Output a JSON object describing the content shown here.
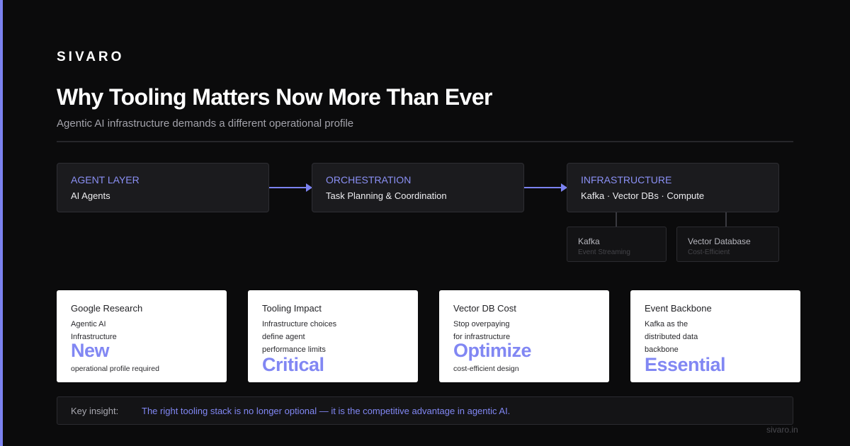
{
  "brand": "SIVARO",
  "title": "Why Tooling Matters Now More Than Ever",
  "subtitle": "Agentic AI infrastructure demands a different operational profile",
  "colors": {
    "accent": "#7b82f0",
    "background": "#0b0b0c",
    "card": "#ffffff",
    "highlight": "#8187f3"
  },
  "flow": [
    {
      "label": "AGENT LAYER",
      "desc": "AI Agents"
    },
    {
      "label": "ORCHESTRATION",
      "desc": "Task Planning & Coordination"
    },
    {
      "label": "INFRASTRUCTURE",
      "desc": "Kafka · Vector DBs · Compute"
    }
  ],
  "sub_components": [
    {
      "name": "Kafka",
      "note": "Event Streaming"
    },
    {
      "name": "Vector Database",
      "note": "Cost-Efficient"
    }
  ],
  "cards": [
    {
      "title": "Google Research",
      "lines": [
        "Agentic AI",
        "Infrastructure"
      ],
      "big": "New",
      "footer": "operational profile required"
    },
    {
      "title": "Tooling Impact",
      "lines": [
        "Infrastructure choices",
        "define agent",
        "performance limits"
      ],
      "big": "Critical",
      "footer": ""
    },
    {
      "title": "Vector DB Cost",
      "lines": [
        "Stop overpaying",
        "for infrastructure"
      ],
      "big": "Optimize",
      "footer": "cost-efficient design"
    },
    {
      "title": "Event Backbone",
      "lines": [
        "Kafka as the",
        "distributed data",
        "backbone"
      ],
      "big": "Essential",
      "footer": ""
    }
  ],
  "insight": {
    "label": "Key insight:",
    "text": "The right tooling stack is no longer optional — it is the competitive advantage in agentic AI."
  },
  "footer_url": "sivaro.in"
}
